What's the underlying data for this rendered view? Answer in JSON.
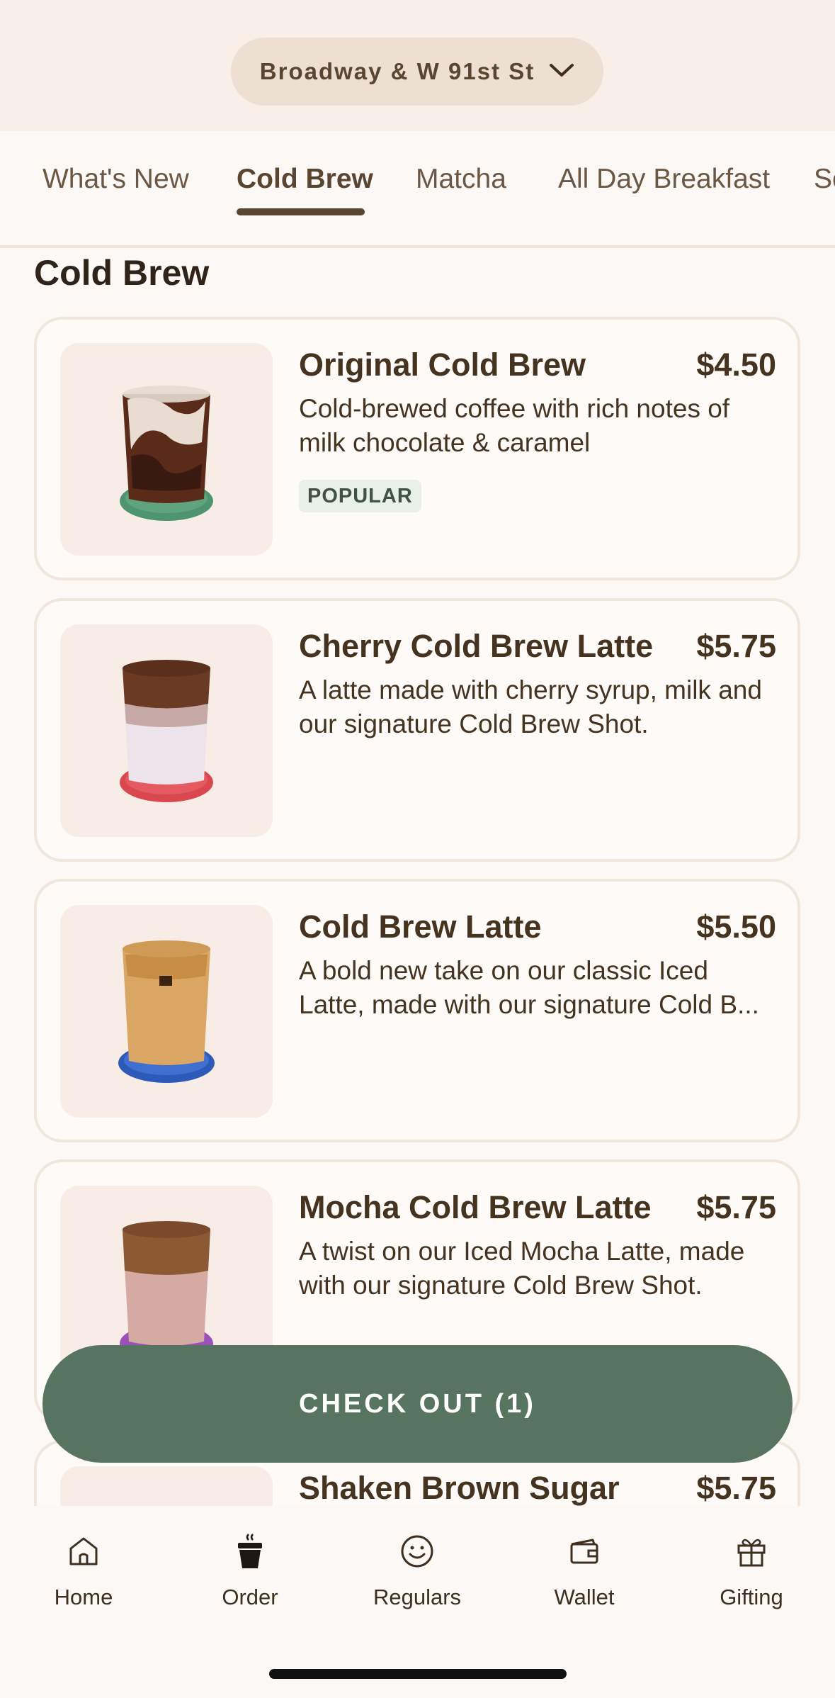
{
  "header": {
    "location": "Broadway & W 91st St",
    "dropdown_icon": "chevron-down-icon"
  },
  "tabs": [
    {
      "label": "What's New",
      "active": false
    },
    {
      "label": "Cold Brew",
      "active": true
    },
    {
      "label": "Matcha",
      "active": false
    },
    {
      "label": "All Day Breakfast",
      "active": false
    },
    {
      "label": "Se",
      "active": false
    }
  ],
  "section": {
    "title": "Cold Brew"
  },
  "menu_items": [
    {
      "name": "Original Cold Brew",
      "price": "$4.50",
      "description": "Cold-brewed coffee with rich notes of milk chocolate & caramel",
      "badge": "POPULAR",
      "coaster_color": "#4f9470"
    },
    {
      "name": "Cherry Cold Brew Latte",
      "price": "$5.75",
      "description": "A latte made with cherry syrup, milk and our signature Cold Brew Shot.",
      "coaster_color": "#d9474f"
    },
    {
      "name": "Cold Brew Latte",
      "price": "$5.50",
      "description": "A bold new take on our classic Iced Latte, made with our signature Cold B...",
      "coaster_color": "#2d5ab8"
    },
    {
      "name": "Mocha Cold Brew Latte",
      "price": "$5.75",
      "description": "A twist on our Iced Mocha Latte, made with our signature Cold Brew Shot.",
      "coaster_color": "#9a52b8"
    },
    {
      "name": "Shaken Brown Sugar",
      "price": "$5.75",
      "description": ""
    }
  ],
  "checkout": {
    "label": "CHECK OUT (1)"
  },
  "bottom_nav": [
    {
      "label": "Home",
      "icon": "home-icon"
    },
    {
      "label": "Order",
      "icon": "cup-icon"
    },
    {
      "label": "Regulars",
      "icon": "smiley-icon"
    },
    {
      "label": "Wallet",
      "icon": "wallet-icon"
    },
    {
      "label": "Gifting",
      "icon": "gift-icon"
    }
  ],
  "colors": {
    "accent_green": "#56745f",
    "brown_text": "#45331f",
    "background": "#fcf8f5"
  }
}
